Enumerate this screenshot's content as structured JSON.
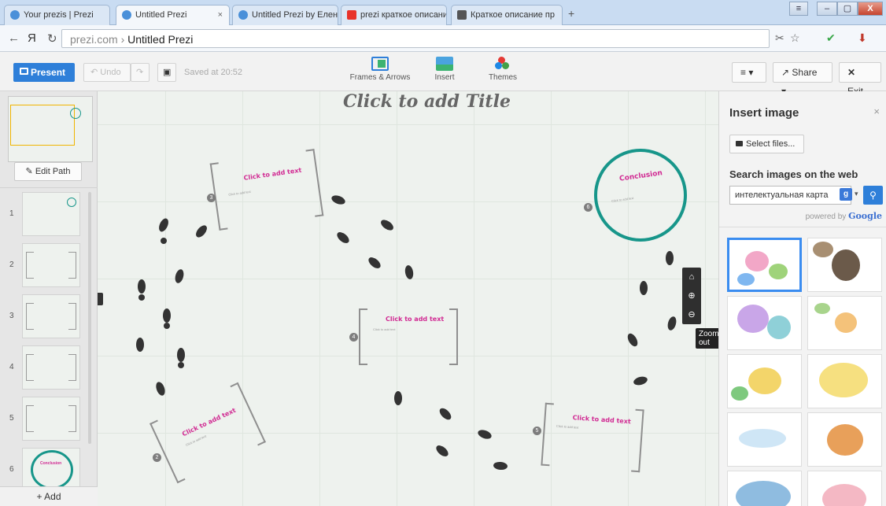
{
  "browser": {
    "tabs": [
      {
        "label": "Your prezis | Prezi",
        "active": false
      },
      {
        "label": "Untitled Prezi",
        "active": true,
        "close": "×"
      },
      {
        "label": "Untitled Prezi by Елен",
        "active": false
      },
      {
        "label": "prezi краткое описани",
        "active": false
      },
      {
        "label": "Краткое описание пр",
        "active": false
      }
    ],
    "new_tab": "+",
    "window_buttons": {
      "minimize": "–",
      "maximize": "▢",
      "close": "X"
    },
    "nav": {
      "back": "←",
      "yandex": "Я",
      "reload": "↻"
    },
    "url_domain": "prezi.com",
    "url_sep": "›",
    "url_page": "Untitled Prezi"
  },
  "toolbar": {
    "present": "Present",
    "undo": "Undo",
    "redo": "↷",
    "save_icon": "🖫",
    "saved_text": "Saved at 20:52",
    "frames_arrows": "Frames & Arrows",
    "insert": "Insert",
    "themes": "Themes",
    "menu": "≡ ▾",
    "share": "Share ▾",
    "exit": "Exit",
    "exit_icon": "✕",
    "share_icon": "↗"
  },
  "left_panel": {
    "edit_path": "Edit Path",
    "add": "+ Add",
    "slides": [
      {
        "num": "1"
      },
      {
        "num": "2"
      },
      {
        "num": "3"
      },
      {
        "num": "4"
      },
      {
        "num": "5"
      },
      {
        "num": "6",
        "label": "Conclusion"
      }
    ]
  },
  "canvas": {
    "title": "Click to add Title",
    "frames": [
      {
        "text": "Click to add text",
        "sub": "Click to add text",
        "dot": "3"
      },
      {
        "text": "Click to add text",
        "sub": "Click to add text",
        "dot": "4"
      },
      {
        "text": "Click to add text",
        "sub": "Click to add text",
        "dot": "5"
      },
      {
        "text": "Click to add text",
        "sub": "Click to add text",
        "dot": "2"
      }
    ],
    "conclusion": {
      "text": "Conclusion",
      "sub": "Click to add text",
      "dot": "6"
    },
    "zoom": {
      "home": "⌂",
      "zoom_in": "⊕",
      "zoom_out": "⊖",
      "tooltip": "Zoom out"
    }
  },
  "right_panel": {
    "title": "Insert image",
    "close": "×",
    "select_files": "Select files...",
    "search_title": "Search images on the web",
    "search_value": "интелектуальная карта",
    "google_btn": "g",
    "search_icon": "⚲",
    "powered_by": "powered by",
    "google_word": "Google"
  },
  "colors": {
    "accent": "#2e7fd9",
    "conclusion": "#17968a",
    "text_pink": "#d12b93"
  }
}
